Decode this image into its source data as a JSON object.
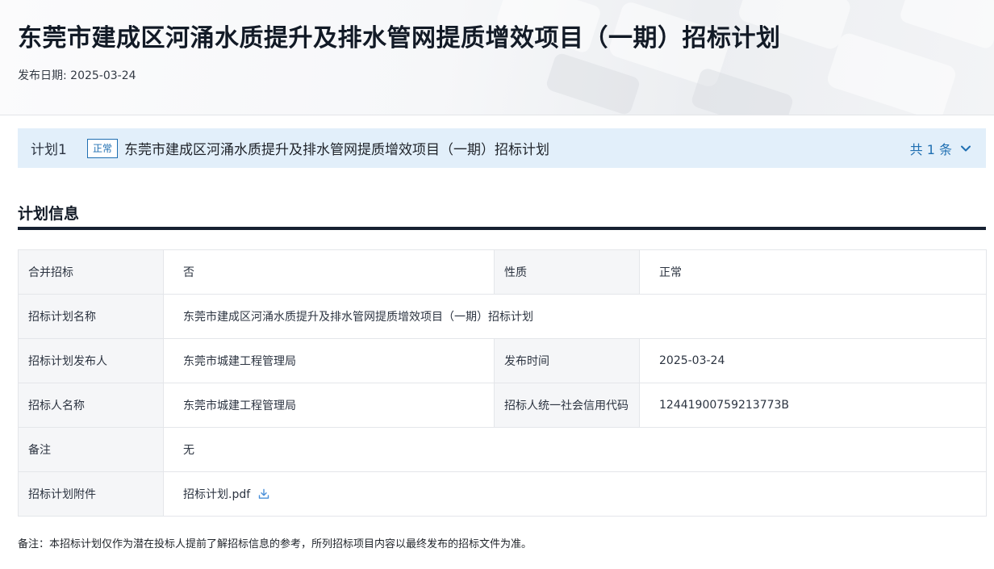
{
  "header": {
    "title": "东莞市建成区河涌水质提升及排水管网提质增效项目（一期）招标计划",
    "publish_date": "发布日期: 2025-03-24"
  },
  "plan_bar": {
    "index": "计划1",
    "badge": "正常",
    "name": "东莞市建成区河涌水质提升及排水管网提质增效项目（一期）招标计划",
    "count": "共 1 条",
    "toggle_icon": "chevron-down-icon"
  },
  "section": {
    "title": "计划信息"
  },
  "info": {
    "merged_label": "合并招标",
    "merged_value": "否",
    "nature_label": "性质",
    "nature_value": "正常",
    "plan_name_label": "招标计划名称",
    "plan_name_value": "东莞市建成区河涌水质提升及排水管网提质增效项目（一期）招标计划",
    "publisher_label": "招标计划发布人",
    "publisher_value": "东莞市城建工程管理局",
    "publish_time_label": "发布时间",
    "publish_time_value": "2025-03-24",
    "tenderer_label": "招标人名称",
    "tenderer_value": "东莞市城建工程管理局",
    "credit_code_label": "招标人统一社会信用代码",
    "credit_code_value": "12441900759213773B",
    "remark_label": "备注",
    "remark_value": "无",
    "attachment_label": "招标计划附件",
    "attachment_value": "招标计划.pdf",
    "attachment_icon": "download-icon"
  },
  "footnote": "备注：本招标计划仅作为潜在投标人提前了解招标信息的参考，所列招标项目内容以最终发布的招标文件为准。",
  "colors": {
    "accent": "#1f6fb2",
    "plan_bar_bg": "#e2effa",
    "title_text": "#121a26",
    "rule": "#162031",
    "label_cell_bg": "#f5f6f8",
    "border": "#e4e6ea"
  }
}
